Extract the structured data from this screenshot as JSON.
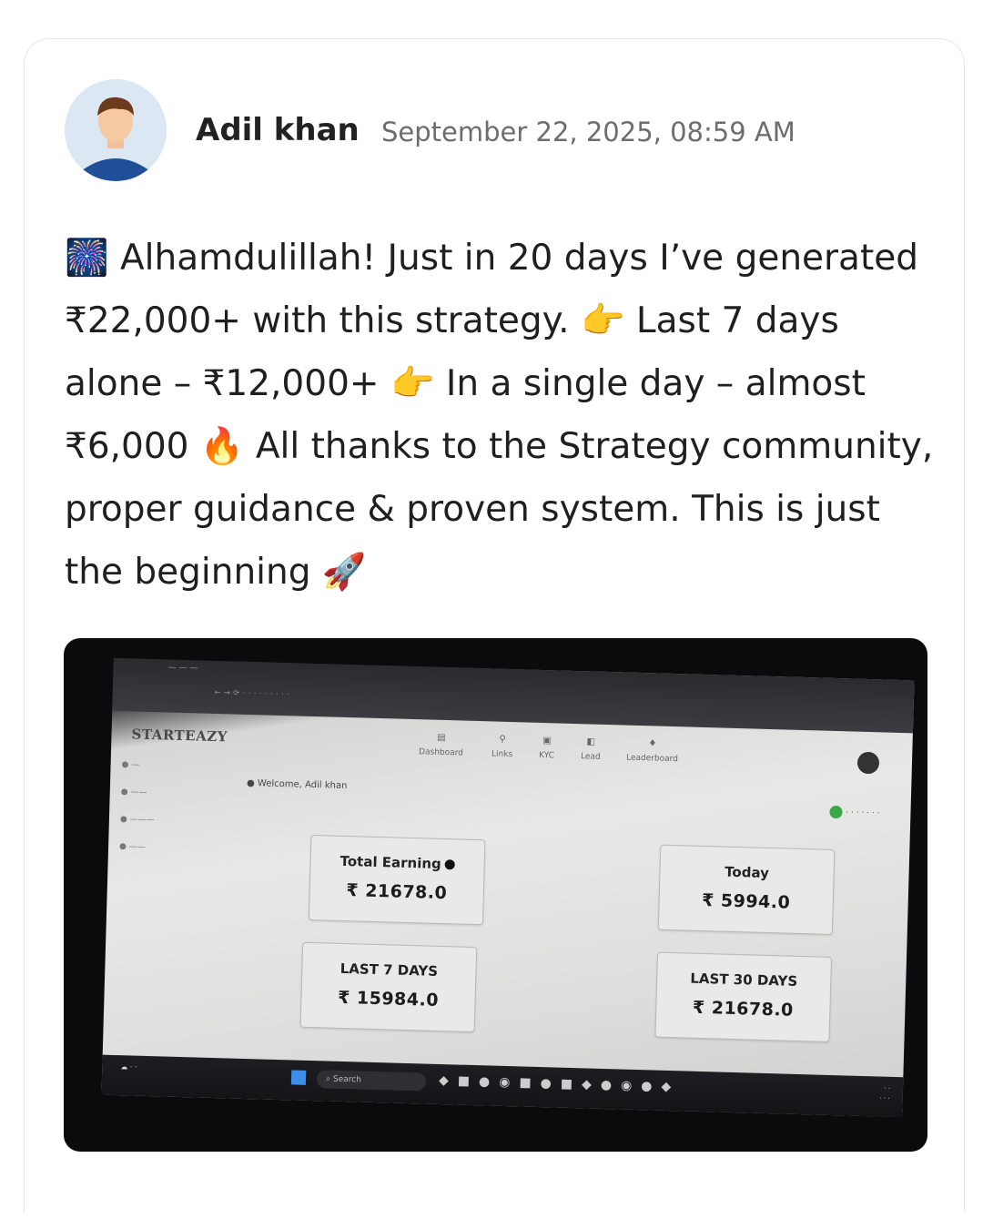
{
  "post": {
    "author": "Adil khan",
    "date": "September 22, 2025, 08:59 AM",
    "text": {
      "emoji_fireworks": "🎆",
      "line1": " Alhamdulillah! Just in 20 days I’ve generated",
      "line2a": "₹22,000+ with this strategy. ",
      "emoji_point1": "👉",
      "line2b": " Last 7 days",
      "line3a": "alone – ₹12,000+ ",
      "emoji_point2": "👉",
      "line3b": " In a single day – almost",
      "line4a": "₹6,000 ",
      "emoji_fire": "🔥",
      "line4b": " All thanks to the Strategy community,",
      "line5": "proper guidance & proven system. This is just",
      "line6": "the beginning ",
      "emoji_rocket": "🚀"
    }
  },
  "screenshot": {
    "brand": "STARTEAZY",
    "nav": [
      {
        "icon": "dashboard-icon",
        "label": "Dashboard"
      },
      {
        "icon": "links-icon",
        "label": "Links"
      },
      {
        "icon": "kyc-icon",
        "label": "KYC"
      },
      {
        "icon": "lead-icon",
        "label": "Lead"
      },
      {
        "icon": "leaderboard-icon",
        "label": "Leaderboard"
      }
    ],
    "welcome": "Welcome, Adil khan",
    "stats": {
      "total_label": "Total Earning",
      "total_value": "₹ 21678.0",
      "today_label": "Today",
      "today_value": "₹ 5994.0",
      "last7_label": "LAST 7 DAYS",
      "last7_value": "₹ 15984.0",
      "last30_label": "LAST 30 DAYS",
      "last30_value": "₹ 21678.0"
    },
    "taskbar": {
      "search": "Search"
    }
  }
}
